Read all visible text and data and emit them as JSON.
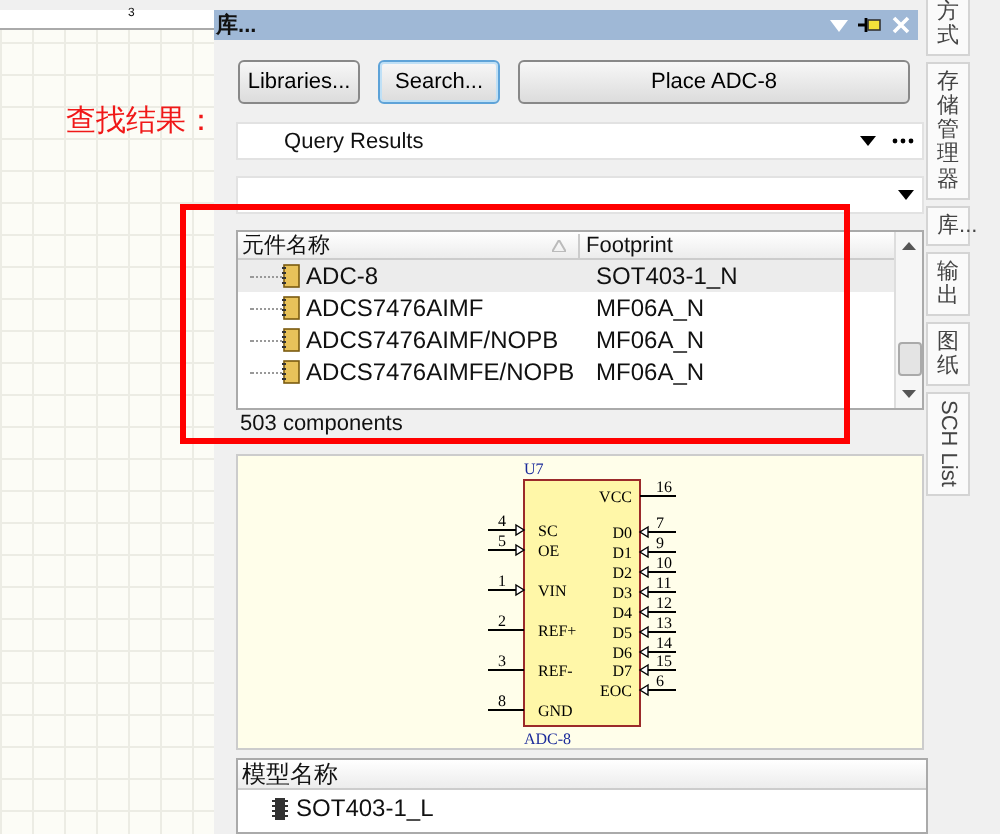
{
  "canvas": {
    "ruler_mark": "3"
  },
  "annotation": {
    "text": "查找结果："
  },
  "panel": {
    "title": "库...",
    "buttons": [
      {
        "label": "Libraries...",
        "selected": false
      },
      {
        "label": "Search...",
        "selected": true
      },
      {
        "label": "Place ADC-8",
        "selected": false
      }
    ],
    "library_field": {
      "value": "Query Results"
    },
    "components": {
      "columns": [
        "元件名称",
        "Footprint"
      ],
      "rows": [
        {
          "name": "ADC-8",
          "footprint": "SOT403-1_N",
          "selected": true
        },
        {
          "name": "ADCS7476AIMF",
          "footprint": "MF06A_N",
          "selected": false
        },
        {
          "name": "ADCS7476AIMF/NOPB",
          "footprint": "MF06A_N",
          "selected": false
        },
        {
          "name": "ADCS7476AIMFE/NOPB",
          "footprint": "MF06A_N",
          "selected": false
        }
      ],
      "count": "503 components"
    },
    "schematic": {
      "designator": "U7",
      "name": "ADC-8",
      "left_pins": [
        {
          "number": "4",
          "label": "SC",
          "arrow": true
        },
        {
          "number": "5",
          "label": "OE",
          "arrow": true
        },
        {
          "number": "1",
          "label": "VIN",
          "arrow": true
        },
        {
          "number": "2",
          "label": "REF+",
          "arrow": false
        },
        {
          "number": "3",
          "label": "REF-",
          "arrow": false
        },
        {
          "number": "8",
          "label": "GND",
          "arrow": false
        }
      ],
      "right_pins": [
        {
          "number": "16",
          "label": "VCC",
          "arrow": false
        },
        {
          "number": "7",
          "label": "D0",
          "arrow": true
        },
        {
          "number": "9",
          "label": "D1",
          "arrow": true
        },
        {
          "number": "10",
          "label": "D2",
          "arrow": true
        },
        {
          "number": "11",
          "label": "D3",
          "arrow": true
        },
        {
          "number": "12",
          "label": "D4",
          "arrow": true
        },
        {
          "number": "13",
          "label": "D5",
          "arrow": true
        },
        {
          "number": "14",
          "label": "D6",
          "arrow": true
        },
        {
          "number": "15",
          "label": "D7",
          "arrow": true
        },
        {
          "number": "6",
          "label": "EOC",
          "arrow": true
        }
      ]
    },
    "models": {
      "column": "模型名称",
      "rows": [
        {
          "name": "SOT403-1_L"
        }
      ]
    }
  },
  "side_tabs": [
    {
      "label": "方式",
      "kind": "cjk"
    },
    {
      "label": "存储管理器",
      "kind": "cjk"
    },
    {
      "label": "库...",
      "kind": "cjk"
    },
    {
      "label": "输出",
      "kind": "cjk"
    },
    {
      "label": "图纸",
      "kind": "cjk"
    },
    {
      "label": "SCH List",
      "kind": "latin"
    }
  ]
}
